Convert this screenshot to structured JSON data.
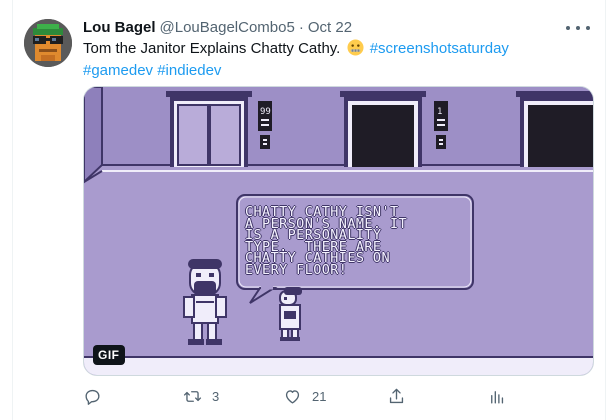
{
  "tweet": {
    "display_name": "Lou Bagel",
    "handle": "@LouBagelCombo5",
    "separator": "·",
    "date": "Oct 22",
    "text_main": "Tom the Janitor Explains Chatty Cathy.",
    "hashtags_line1": "#screenshotsaturday",
    "hashtags_line2": "#gamedev #indiedev"
  },
  "media": {
    "gif_label": "GIF",
    "floor_left": "99",
    "floor_right": "1",
    "speech_text": "CHATTY CATHY ISN'T\nA PERSON'S NAME. IT\nIS A PERSONALITY\nTYPE.  THERE ARE\nCHATTY CATHIES ON\nEVERY FLOOR!",
    "colors": {
      "wall": "#a99bce",
      "outline": "#3f3567",
      "light": "#f0edfa",
      "dark": "#1f1c26"
    }
  },
  "actions": {
    "reply_count": "",
    "retweet_count": "3",
    "like_count": "21",
    "share_count": "",
    "analytics_count": ""
  },
  "icons": {
    "more": "more-icon",
    "reply": "reply-icon",
    "retweet": "retweet-icon",
    "like": "heart-icon",
    "share": "share-icon",
    "analytics": "analytics-icon"
  },
  "colors": {
    "link": "#1d9bf0",
    "secondary_text": "#536471"
  }
}
